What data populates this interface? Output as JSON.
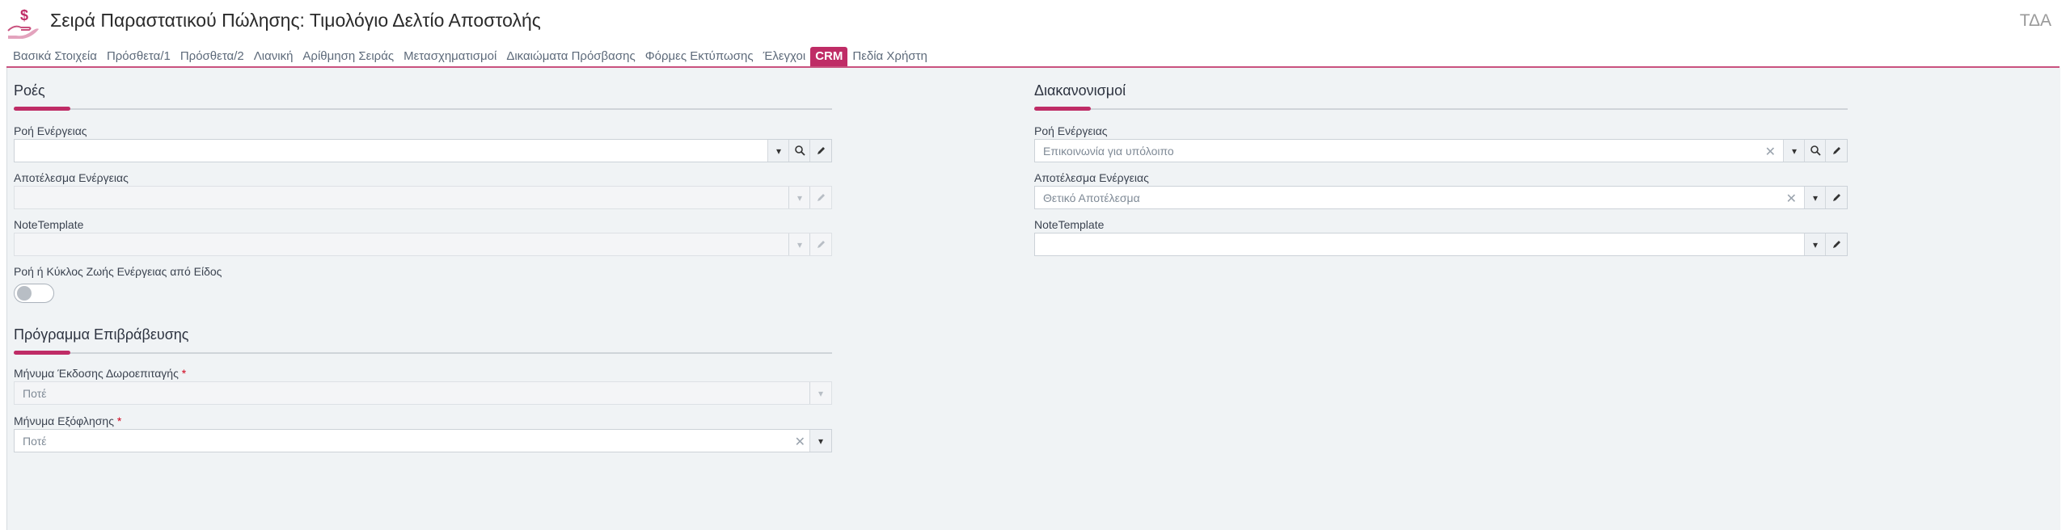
{
  "header": {
    "title": "Σειρά Παραστατικού Πώλησης: Τιμολόγιο Δελτίο Αποστολής",
    "company": "ΤΔΑ",
    "logo_icon": "hand-dollar-icon"
  },
  "tabs": [
    {
      "label": "Βασικά Στοιχεία",
      "active": false
    },
    {
      "label": "Πρόσθετα/1",
      "active": false
    },
    {
      "label": "Πρόσθετα/2",
      "active": false
    },
    {
      "label": "Λιανική",
      "active": false
    },
    {
      "label": "Αρίθμηση Σειράς",
      "active": false
    },
    {
      "label": "Μετασχηματισμοί",
      "active": false
    },
    {
      "label": "Δικαιώματα Πρόσβασης",
      "active": false
    },
    {
      "label": "Φόρμες Εκτύπωσης",
      "active": false
    },
    {
      "label": "Έλεγχοι",
      "active": false
    },
    {
      "label": "CRM",
      "active": true
    },
    {
      "label": "Πεδία Χρήστη",
      "active": false
    }
  ],
  "left": {
    "flows_title": "Ροές",
    "flow_label": "Ροή Ενέργειας",
    "flow_value": "",
    "result_label": "Αποτέλεσμα Ενέργειας",
    "result_value": "",
    "note_label": "NoteTemplate",
    "note_value": "",
    "toggle_label": "Ροή ή Κύκλος Ζωής Ενέργειας από Είδος",
    "toggle_on": false,
    "reward_title": "Πρόγραμμα Επιβράβευσης",
    "voucher_label": "Μήνυμα Έκδοσης Δωροεπιταγής",
    "voucher_value": "Ποτέ",
    "payoff_label": "Μήνυμα Εξόφλησης",
    "payoff_value": "Ποτέ",
    "required_mark": "*"
  },
  "right": {
    "settle_title": "Διακανονισμοί",
    "flow_label": "Ροή Ενέργειας",
    "flow_value": "Επικοινωνία για υπόλοιπο",
    "result_label": "Αποτέλεσμα Ενέργειας",
    "result_value": "Θετικό Αποτέλεσμα",
    "note_label": "NoteTemplate",
    "note_value": ""
  },
  "colors": {
    "accent": "#bf2c66",
    "panel_bg": "#f0f3f5"
  }
}
